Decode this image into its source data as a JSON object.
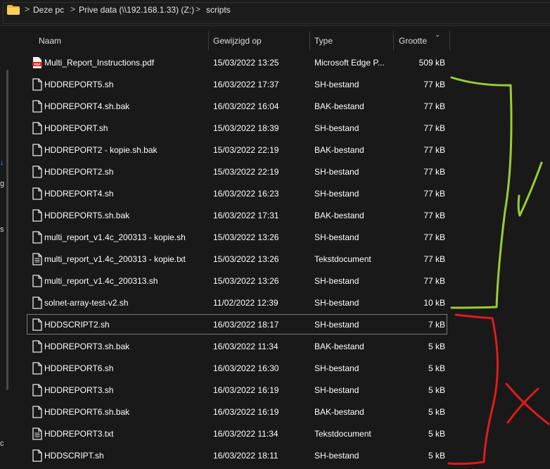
{
  "addressbar": {
    "crumbs": [
      "Deze pc",
      "Prive data (\\\\192.168.1.33) (Z:)",
      "scripts"
    ],
    "separator": ">"
  },
  "leftpane": {
    "glyphs": [
      "↓",
      "g",
      "s",
      "c"
    ]
  },
  "columns": {
    "name": "Naam",
    "modified": "Gewijzigd op",
    "type": "Type",
    "size": "Grootte"
  },
  "files": [
    {
      "name": "Multi_Report_Instructions.pdf",
      "modified": "15/03/2022 13:25",
      "type": "Microsoft Edge P...",
      "size": "509 kB",
      "icon": "pdf-icon"
    },
    {
      "name": "HDDREPORT5.sh",
      "modified": "16/03/2022 17:37",
      "type": "SH-bestand",
      "size": "77 kB",
      "icon": "file-icon"
    },
    {
      "name": "HDDREPORT4.sh.bak",
      "modified": "16/03/2022 16:04",
      "type": "BAK-bestand",
      "size": "77 kB",
      "icon": "file-icon"
    },
    {
      "name": "HDDREPORT.sh",
      "modified": "15/03/2022 18:39",
      "type": "SH-bestand",
      "size": "77 kB",
      "icon": "file-icon"
    },
    {
      "name": "HDDREPORT2 - kopie.sh.bak",
      "modified": "15/03/2022 22:19",
      "type": "BAK-bestand",
      "size": "77 kB",
      "icon": "file-icon"
    },
    {
      "name": "HDDREPORT2.sh",
      "modified": "15/03/2022 22:19",
      "type": "SH-bestand",
      "size": "77 kB",
      "icon": "file-icon"
    },
    {
      "name": "HDDREPORT4.sh",
      "modified": "16/03/2022 16:23",
      "type": "SH-bestand",
      "size": "77 kB",
      "icon": "file-icon"
    },
    {
      "name": "HDDREPORT5.sh.bak",
      "modified": "16/03/2022 17:31",
      "type": "BAK-bestand",
      "size": "77 kB",
      "icon": "file-icon"
    },
    {
      "name": "multi_report_v1.4c_200313 - kopie.sh",
      "modified": "15/03/2022 13:26",
      "type": "SH-bestand",
      "size": "77 kB",
      "icon": "file-icon"
    },
    {
      "name": "multi_report_v1.4c_200313 - kopie.txt",
      "modified": "15/03/2022 13:26",
      "type": "Tekstdocument",
      "size": "77 kB",
      "icon": "text-file-icon"
    },
    {
      "name": "multi_report_v1.4c_200313.sh",
      "modified": "15/03/2022 13:26",
      "type": "SH-bestand",
      "size": "77 kB",
      "icon": "file-icon"
    },
    {
      "name": "solnet-array-test-v2.sh",
      "modified": "11/02/2022 12:39",
      "type": "SH-bestand",
      "size": "10 kB",
      "icon": "file-icon"
    },
    {
      "name": "HDDSCRIPT2.sh",
      "modified": "16/03/2022 18:17",
      "type": "SH-bestand",
      "size": "7 kB",
      "icon": "file-icon",
      "selected": true
    },
    {
      "name": "HDDREPORT3.sh.bak",
      "modified": "16/03/2022 11:34",
      "type": "BAK-bestand",
      "size": "5 kB",
      "icon": "file-icon"
    },
    {
      "name": "HDDREPORT6.sh",
      "modified": "16/03/2022 16:30",
      "type": "SH-bestand",
      "size": "5 kB",
      "icon": "file-icon"
    },
    {
      "name": "HDDREPORT3.sh",
      "modified": "16/03/2022 16:19",
      "type": "SH-bestand",
      "size": "5 kB",
      "icon": "file-icon"
    },
    {
      "name": "HDDREPORT6.sh.bak",
      "modified": "16/03/2022 16:19",
      "type": "BAK-bestand",
      "size": "5 kB",
      "icon": "file-icon"
    },
    {
      "name": "HDDREPORT3.txt",
      "modified": "16/03/2022 11:34",
      "type": "Tekstdocument",
      "size": "5 kB",
      "icon": "text-file-icon"
    },
    {
      "name": "HDDSCRIPT.sh",
      "modified": "16/03/2022 18:11",
      "type": "SH-bestand",
      "size": "5 kB",
      "icon": "file-icon"
    }
  ],
  "annotations": {
    "green_color": "#9acd32",
    "red_color": "#dd1c1a",
    "green_mark": "checkmark",
    "red_mark": "cross"
  }
}
